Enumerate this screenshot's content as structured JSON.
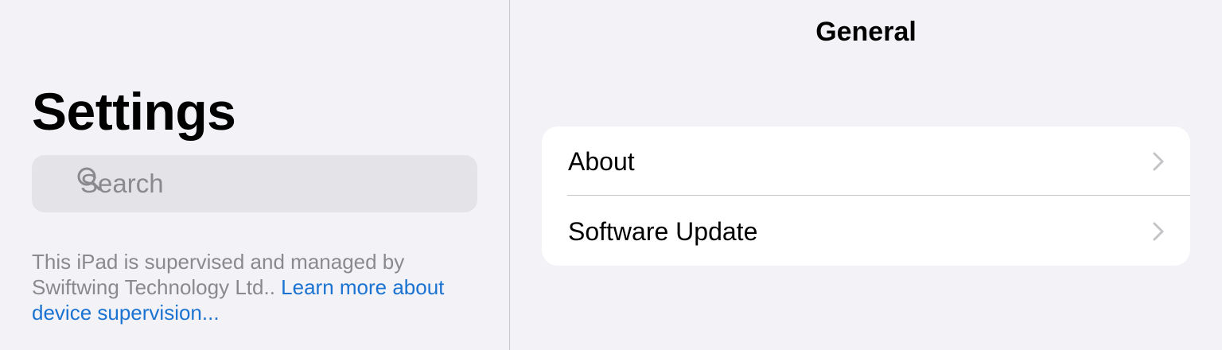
{
  "sidebar": {
    "title": "Settings",
    "search": {
      "placeholder": "Search",
      "icon": "magnifying-glass-icon"
    },
    "supervision_note": {
      "text": "This iPad is supervised and managed by Swiftwing Technology Ltd.. ",
      "link": "Learn more about device supervision..."
    }
  },
  "detail": {
    "nav_title": "General",
    "rows": [
      {
        "label": "About",
        "icon": "chevron-right-icon"
      },
      {
        "label": "Software Update",
        "icon": "chevron-right-icon"
      }
    ]
  },
  "colors": {
    "background": "#f2f2f7",
    "search_field": "#e3e3e8",
    "secondary_text": "#8a8a8e",
    "link": "#1a73d1",
    "card": "#ffffff",
    "chevron": "#c4c4c7"
  }
}
